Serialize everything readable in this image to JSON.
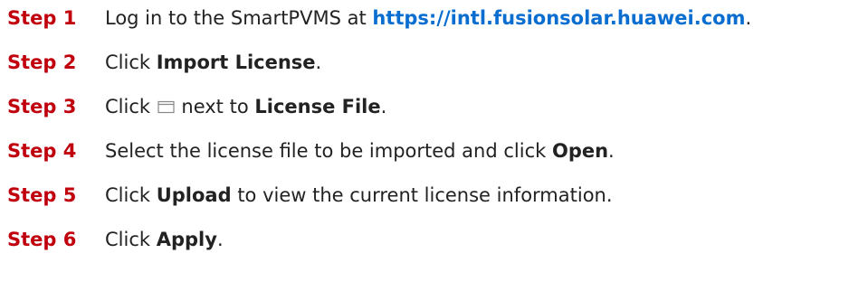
{
  "steps": [
    {
      "label": "Step 1",
      "prefix": "Log in to the SmartPVMS at ",
      "link": "https://intl.fusionsolar.huawei.com",
      "suffix": "."
    },
    {
      "label": "Step 2",
      "prefix": "Click ",
      "bold": "Import License",
      "suffix": "."
    },
    {
      "label": "Step 3",
      "prefix": "Click ",
      "icon": "folder-icon",
      "middle": " next to ",
      "bold": "License File",
      "suffix": "."
    },
    {
      "label": "Step 4",
      "prefix": "Select the license file to be imported and click ",
      "bold": "Open",
      "suffix": "."
    },
    {
      "label": "Step 5",
      "prefix": "Click ",
      "bold": "Upload",
      "suffix": " to view the current license information."
    },
    {
      "label": "Step 6",
      "prefix": "Click ",
      "bold": "Apply",
      "suffix": "."
    }
  ],
  "colors": {
    "step_label": "#c0000c",
    "link": "#0a6ed1",
    "text": "#222222"
  }
}
